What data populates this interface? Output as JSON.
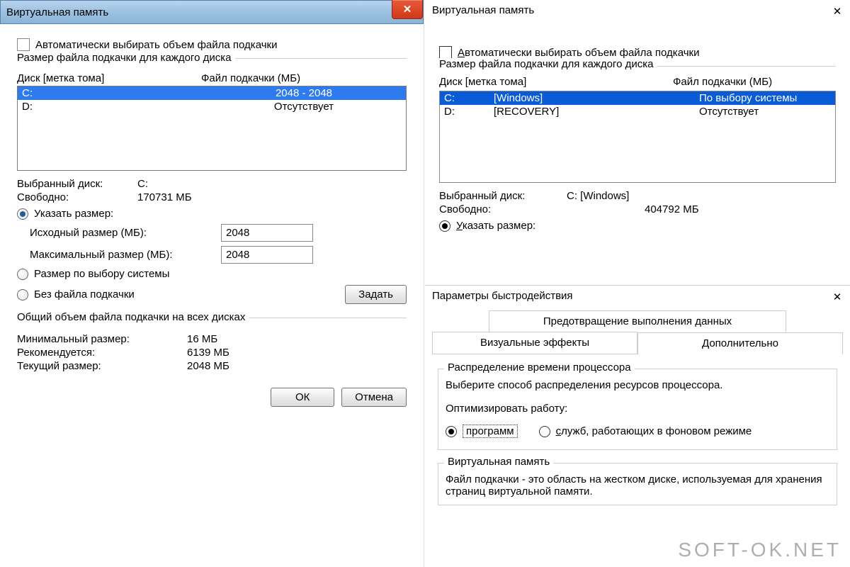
{
  "left": {
    "title": "Виртуальная память",
    "close_x": "X",
    "auto_checkbox": "Автоматически выбирать объем файла подкачки",
    "drives_group": "Размер файла подкачки для каждого диска",
    "col_drive": "Диск [метка тома]",
    "col_paging": "Файл подкачки (МБ)",
    "drives": [
      {
        "drive": "C:",
        "value": "2048 - 2048",
        "selected": true
      },
      {
        "drive": "D:",
        "value": "Отсутствует",
        "selected": false
      }
    ],
    "selected_drive_label": "Выбранный диск:",
    "selected_drive_value": "C:",
    "free_label": "Свободно:",
    "free_value": "170731 МБ",
    "radio_custom": "Указать размер:",
    "initial_label": "Исходный размер (МБ):",
    "initial_value": "2048",
    "max_label": "Максимальный размер (МБ):",
    "max_value": "2048",
    "radio_system": "Размер по выбору системы",
    "radio_none": "Без файла подкачки",
    "set_button": "Задать",
    "total_group": "Общий объем файла подкачки на всех дисках",
    "minimum_label": "Минимальный размер:",
    "minimum_value": "16 МБ",
    "recommended_label": "Рекомендуется:",
    "recommended_value": "6139 МБ",
    "current_label": "Текущий размер:",
    "current_value": "2048 МБ",
    "ok": "ОК",
    "cancel": "Отмена"
  },
  "right_vm": {
    "title": "Виртуальная память",
    "auto_a": "А",
    "auto_rest": "втоматически выбирать объем файла подкачки",
    "drives_group": "Размер файла подкачки для каждого диска",
    "col_d": "Д",
    "col_drive_rest": "иск [метка тома]",
    "col_paging": "Файл подкачки (МБ)",
    "drives": [
      {
        "drive": "C:",
        "label": "[Windows]",
        "value": "По выбору системы",
        "selected": true
      },
      {
        "drive": "D:",
        "label": "[RECOVERY]",
        "value": "Отсутствует",
        "selected": false
      }
    ],
    "selected_drive_label": "Выбранный диск:",
    "selected_drive_value": "C:  [Windows]",
    "free_label": "Свободно:",
    "free_value": "404792 МБ",
    "custom_u": "У",
    "custom_rest": "казать размер:"
  },
  "perf": {
    "title": "Параметры быстродействия",
    "tab_dep": "Предотвращение выполнения данных",
    "tab_visual": "Визуальные эффекты",
    "tab_advanced": "Дополнительно",
    "cpu_group": "Распределение времени процессора",
    "cpu_desc": "Выберите способ распределения ресурсов процессора.",
    "optimize_label": "Оптимизировать работу:",
    "radio_programs": "программ",
    "radio_services_prefix": "с",
    "radio_services_rest": "лужб, работающих в фоновом режиме",
    "vm_group": "Виртуальная память",
    "vm_desc": "Файл подкачки - это область на жестком диске, используемая для хранения страниц виртуальной памяти."
  },
  "watermark": "SOFT-OK.NET"
}
